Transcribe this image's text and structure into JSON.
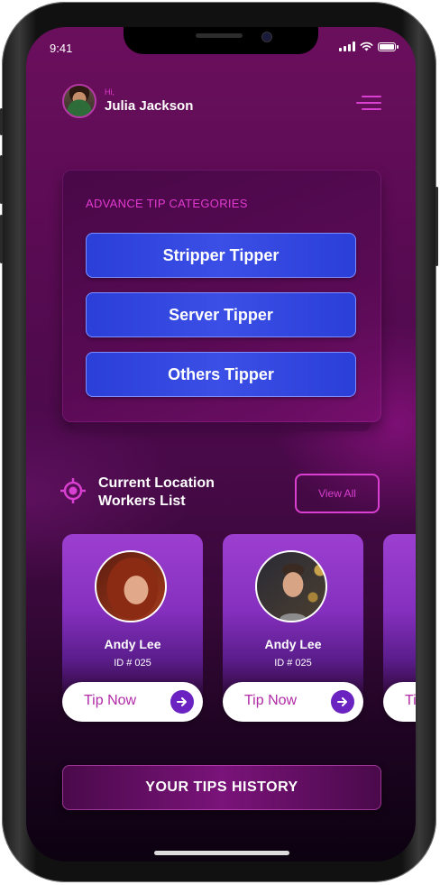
{
  "status_bar": {
    "time": "9:41"
  },
  "header": {
    "greeting": "Hi,",
    "user_name": "Julia Jackson"
  },
  "categories": {
    "title": "ADVANCE TIP CATEGORIES",
    "items": [
      {
        "label": "Stripper Tipper"
      },
      {
        "label": "Server Tipper"
      },
      {
        "label": "Others Tipper"
      }
    ]
  },
  "workers": {
    "title_line1": "Current Location",
    "title_line2": "Workers List",
    "view_all_label": "View All",
    "cards": [
      {
        "name": "Andy Lee",
        "id": "ID # 025",
        "tip_label": "Tip Now"
      },
      {
        "name": "Andy Lee",
        "id": "ID # 025",
        "tip_label": "Tip Now"
      },
      {
        "name": "",
        "id": "",
        "tip_label": "Ti"
      }
    ]
  },
  "history": {
    "label": "YOUR TIPS HISTORY"
  },
  "colors": {
    "accent": "#d93fd0",
    "button_blue": "#2a3fd8",
    "card_purple": "#9c3fd0",
    "tip_text": "#b22aa8"
  }
}
